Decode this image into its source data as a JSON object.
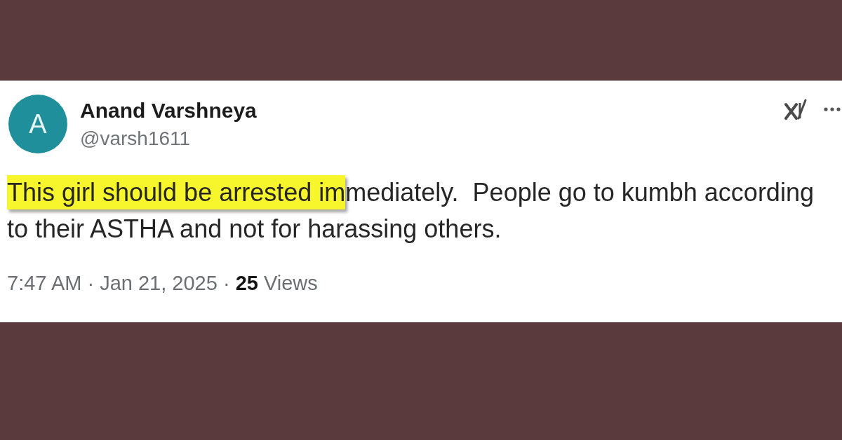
{
  "post": {
    "author": {
      "initial": "A",
      "name": "Anand Varshneya",
      "handle": "@varsh1611"
    },
    "text": [
      {
        "text": "This girl should be arrested im",
        "highlighted": true
      },
      {
        "text": "mediately.  People go to kumbh according to their ASTHA and not for harassing others.",
        "highlighted": false
      }
    ],
    "meta": "7:47 AM · Jan 21, 2025 · **25** Views"
  }
}
